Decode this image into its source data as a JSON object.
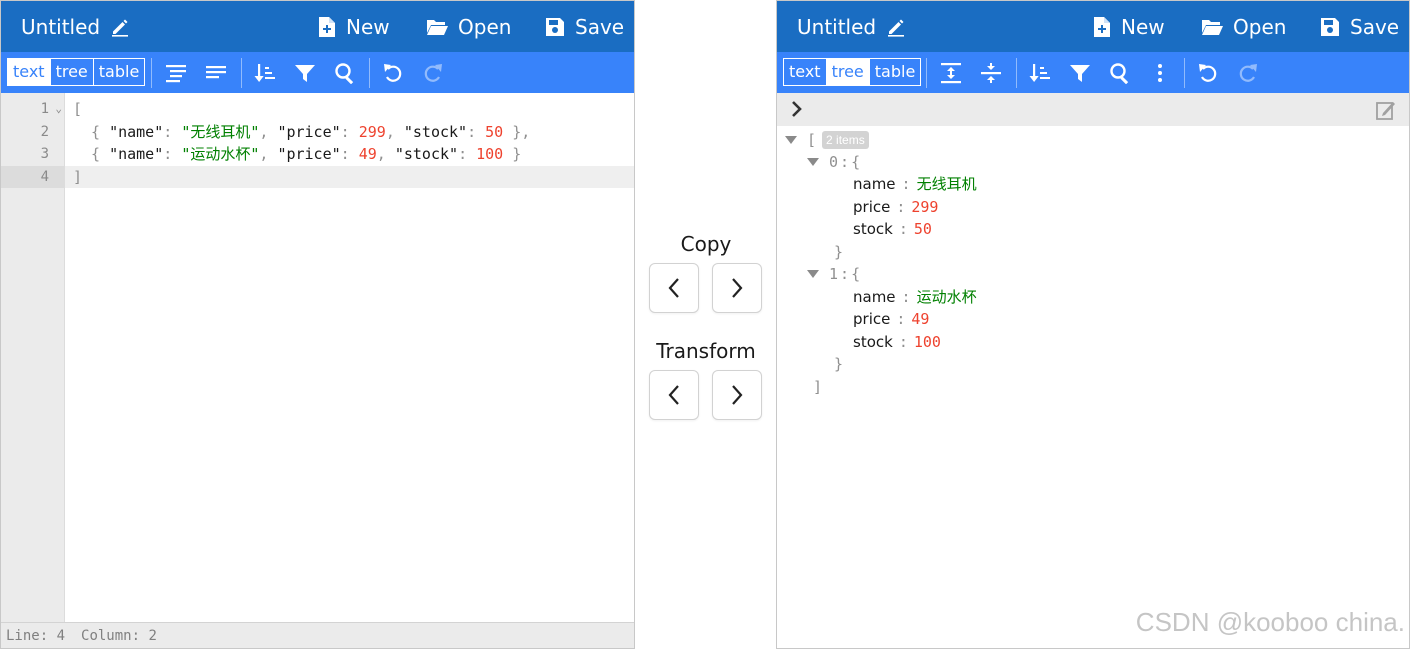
{
  "left": {
    "title": "Untitled",
    "menu": {
      "new": "New",
      "open": "Open",
      "save": "Save"
    },
    "modes": [
      {
        "label": "text",
        "active": true
      },
      {
        "label": "tree",
        "active": false
      },
      {
        "label": "table",
        "active": false
      }
    ],
    "code": {
      "line_numbers": [
        "1",
        "2",
        "3",
        "4"
      ],
      "lines": [
        {
          "open": "["
        },
        {
          "name_key": "\"name\"",
          "name_val": "\"无线耳机\"",
          "price_key": "\"price\"",
          "price_val": "299",
          "stock_key": "\"stock\"",
          "stock_val": "50"
        },
        {
          "name_key": "\"name\"",
          "name_val": "\"运动水杯\"",
          "price_key": "\"price\"",
          "price_val": "49",
          "stock_key": "\"stock\"",
          "stock_val": "100"
        },
        {
          "close": "]"
        }
      ]
    },
    "status": {
      "line": "Line: 4",
      "column": "Column: 2"
    }
  },
  "middle": {
    "copy_label": "Copy",
    "transform_label": "Transform"
  },
  "right": {
    "title": "Untitled",
    "menu": {
      "new": "New",
      "open": "Open",
      "save": "Save"
    },
    "modes": [
      {
        "label": "text",
        "active": false
      },
      {
        "label": "tree",
        "active": true
      },
      {
        "label": "table",
        "active": false
      }
    ],
    "tree": {
      "root_open": "[",
      "root_badge": "2 items",
      "root_close": "]",
      "items": [
        {
          "index": "0",
          "open": "{",
          "close": "}",
          "fields": [
            {
              "key": "name",
              "value": "无线耳机",
              "kind": "string"
            },
            {
              "key": "price",
              "value": "299",
              "kind": "number"
            },
            {
              "key": "stock",
              "value": "50",
              "kind": "number"
            }
          ]
        },
        {
          "index": "1",
          "open": "{",
          "close": "}",
          "fields": [
            {
              "key": "name",
              "value": "运动水杯",
              "kind": "string"
            },
            {
              "key": "price",
              "value": "49",
              "kind": "number"
            },
            {
              "key": "stock",
              "value": "100",
              "kind": "number"
            }
          ]
        }
      ]
    }
  },
  "watermark": "CSDN @kooboo china.",
  "colors": {
    "topbar": "#1a6dc2",
    "toolbar": "#3883fa",
    "string": "#008000",
    "number": "#ee422e"
  }
}
